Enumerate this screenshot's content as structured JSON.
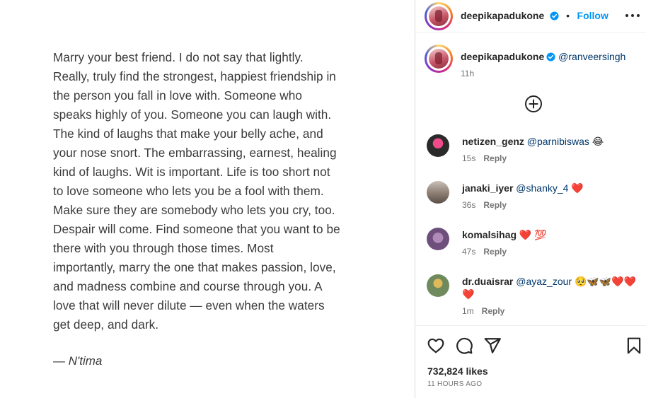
{
  "post": {
    "quote_lines": [
      "Marry your best friend. I do not say that lightly.",
      "Really, truly find the strongest, happiest friendship in",
      "the person you fall in love with. Someone who",
      "speaks highly of you. Someone you can laugh with.",
      "The kind of laughs that make your belly ache, and",
      "your nose snort. The embarrassing, earnest, healing",
      "kind of laughs. Wit is important. Life is too short not",
      "to love someone who lets you be a fool with them.",
      "Make sure they are somebody who lets you cry, too.",
      "Despair will come. Find someone that you want to be",
      "there with you through those times. Most",
      "importantly, marry the one that makes passion, love,",
      "and madness combine and course through you. A",
      "love that will never dilute — even when the waters",
      "get deep, and dark."
    ],
    "attribution": "— N'tima"
  },
  "header": {
    "username": "deepikapadukone",
    "separator": "•",
    "follow_label": "Follow",
    "more_icon": "more-horizontal-icon"
  },
  "caption": {
    "username": "deepikapadukone",
    "mention": "@ranveersingh",
    "time": "11h"
  },
  "load_more_icon": "plus-circle-icon",
  "comments": [
    {
      "username": "netizen_genz",
      "mention": "@parnibiswas",
      "emoji": "😂",
      "time": "15s",
      "reply": "Reply"
    },
    {
      "username": "janaki_iyer",
      "mention": "@shanky_4",
      "emoji": "❤️",
      "time": "36s",
      "reply": "Reply"
    },
    {
      "username": "komalsihag",
      "mention": "",
      "emoji": "❤️ 💯",
      "time": "47s",
      "reply": "Reply"
    },
    {
      "username": "dr.duaisrar",
      "mention": "@ayaz_zour",
      "emoji": "🥺🦋🦋❤️❤️ ❤️",
      "time": "1m",
      "reply": "Reply"
    }
  ],
  "actions": {
    "icons": [
      "heart-icon",
      "comment-icon",
      "share-icon",
      "bookmark-icon"
    ],
    "likes": "732,824 likes",
    "time_ago": "11 HOURS AGO"
  },
  "colors": {
    "accent": "#0095f6",
    "mention": "#00376b",
    "muted": "#737373",
    "heart": "#ed4956"
  }
}
